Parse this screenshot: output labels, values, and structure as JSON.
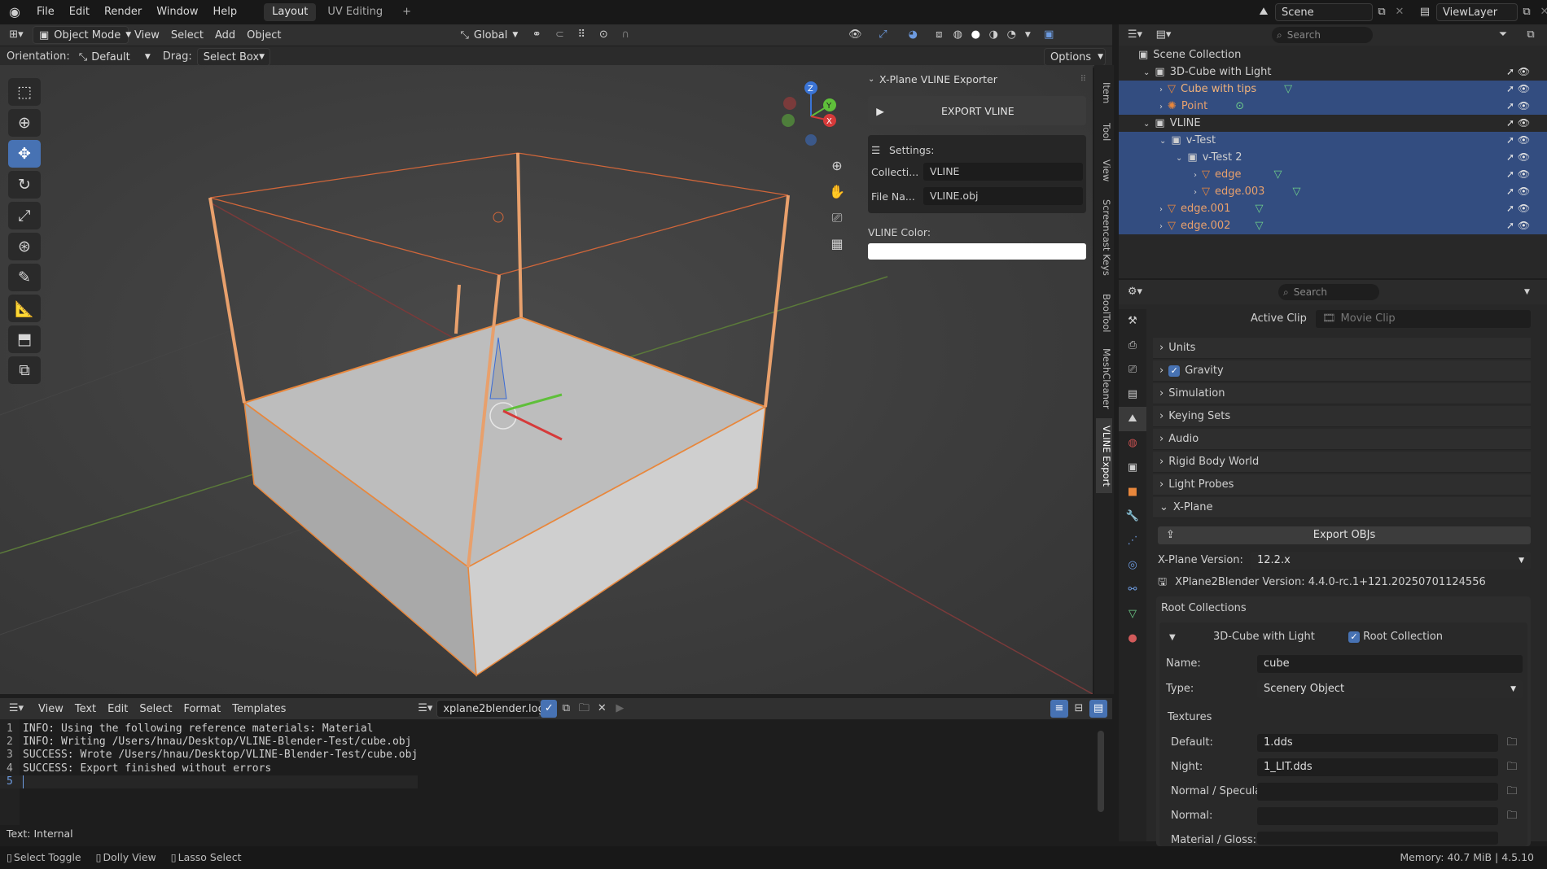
{
  "topbar": {
    "menus": [
      "File",
      "Edit",
      "Render",
      "Window",
      "Help"
    ],
    "tabs": [
      "Layout",
      "UV Editing"
    ],
    "add_tab": "+",
    "scene_label": "Scene",
    "viewlayer_label": "ViewLayer"
  },
  "viewport_header": {
    "mode": "Object Mode",
    "menus": [
      "View",
      "Select",
      "Add",
      "Object"
    ],
    "transform": "Global",
    "orientation_label": "Orientation:",
    "orientation_value": "Default",
    "drag_label": "Drag:",
    "drag_value": "Select Box",
    "options": "Options"
  },
  "vline_panel": {
    "title": "X-Plane VLINE Exporter",
    "export_button": "EXPORT VLINE",
    "settings_label": "Settings:",
    "collection_label": "Collecti...",
    "collection_value": "VLINE",
    "filename_label": "File Na...",
    "filename_value": "VLINE.obj",
    "color_label": "VLINE Color:",
    "color_value": "#ffffff"
  },
  "side_tabs": [
    "Item",
    "Tool",
    "View",
    "Screencast Keys",
    "BoolTool",
    "MeshCleaner",
    "VLINE Export"
  ],
  "outliner": {
    "search_placeholder": "Search",
    "root": "Scene Collection",
    "rows": [
      {
        "label": "3D-Cube with Light",
        "selected": false
      },
      {
        "label": "Cube with tips",
        "selected": true
      },
      {
        "label": "Point",
        "selected": true
      },
      {
        "label": "VLINE",
        "selected": false
      },
      {
        "label": "v-Test",
        "selected": true
      },
      {
        "label": "v-Test 2",
        "selected": true
      },
      {
        "label": "edge",
        "selected": true
      },
      {
        "label": "edge.003",
        "selected": true
      },
      {
        "label": "edge.001",
        "selected": true
      },
      {
        "label": "edge.002",
        "selected": true
      }
    ]
  },
  "properties": {
    "search_placeholder": "Search",
    "active_clip_label": "Active Clip",
    "active_clip_placeholder": "Movie Clip",
    "sections": [
      "Units",
      "Gravity",
      "Simulation",
      "Keying Sets",
      "Audio",
      "Rigid Body World",
      "Light Probes",
      "X-Plane"
    ],
    "export_objs": "Export OBJs",
    "xp_version_label": "X-Plane Version:",
    "xp_version_value": "12.2.x",
    "x2b_version": "XPlane2Blender Version: 4.4.0-rc.1+121.20250701124556",
    "root_collections_label": "Root Collections",
    "collection_name": "3D-Cube with Light",
    "root_collection_label": "Root Collection",
    "name_label": "Name:",
    "name_value": "cube",
    "type_label": "Type:",
    "type_value": "Scenery Object",
    "textures_label": "Textures",
    "default_label": "Default:",
    "default_value": "1.dds",
    "night_label": "Night:",
    "night_value": "1_LIT.dds",
    "normal_spec_label": "Normal / Specular:",
    "normal_label": "Normal:",
    "material_gloss_label": "Material / Gloss:"
  },
  "text_editor": {
    "menus": [
      "View",
      "Text",
      "Edit",
      "Select",
      "Format",
      "Templates"
    ],
    "filename": "xplane2blender.log",
    "lines": [
      {
        "num": "1",
        "text": "INFO: Using the following reference materials: Material"
      },
      {
        "num": "2",
        "text": "INFO: Writing /Users/hnau/Desktop/VLINE-Blender-Test/cube.obj"
      },
      {
        "num": "3",
        "text": "SUCCESS: Wrote /Users/hnau/Desktop/VLINE-Blender-Test/cube.obj"
      },
      {
        "num": "4",
        "text": "SUCCESS: Export finished without errors"
      },
      {
        "num": "5",
        "text": ""
      }
    ],
    "footer": "Text: Internal"
  },
  "statusbar": {
    "left": [
      "Select Toggle",
      "Dolly View",
      "Lasso Select"
    ],
    "right": "Memory: 40.7 MiB | 4.5.10"
  },
  "colors": {
    "accent": "#4772b3",
    "selected_row": "#334d80",
    "outline": "#e8873c"
  }
}
